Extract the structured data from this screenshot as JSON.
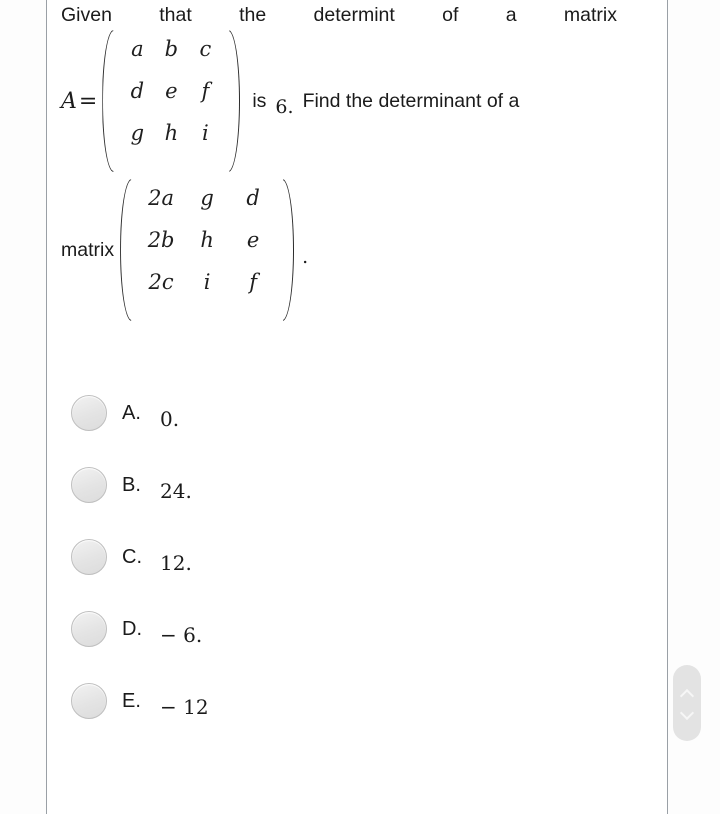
{
  "document": {
    "question": {
      "line1_words": [
        "Given",
        "that",
        "the",
        "determint",
        "of",
        "a",
        "matrix"
      ],
      "variable": "A",
      "equals": "=",
      "matrix_a": {
        "rows": [
          [
            "a",
            "b",
            "c"
          ],
          [
            "d",
            "e",
            "f"
          ],
          [
            "g",
            "h",
            "i"
          ]
        ]
      },
      "is_word": "is",
      "determinant_value": "6.",
      "tail_text": "Find the determinant of a",
      "matrix_label": "matrix",
      "matrix_b": {
        "rows": [
          [
            "2a",
            "g",
            "d"
          ],
          [
            "2b",
            "h",
            "e"
          ],
          [
            "2c",
            "i",
            "f"
          ]
        ]
      },
      "trailing_period": "."
    },
    "options": [
      {
        "letter": "A.",
        "value": "0."
      },
      {
        "letter": "B.",
        "value": "24."
      },
      {
        "letter": "C.",
        "value": "12."
      },
      {
        "letter": "D.",
        "value": "− 6."
      },
      {
        "letter": "E.",
        "value": "− 12"
      }
    ],
    "scroll_nav": {
      "up_icon": "chevron-up-icon",
      "down_icon": "chevron-down-icon"
    },
    "colors": {
      "background": "#ffffff",
      "text": "#1b1b1b",
      "divider": "#9aa0a6",
      "radio_fill": "#e4e4e4",
      "radio_border": "#bfbfbf",
      "scroll_pill": "#e3e3e3"
    }
  }
}
